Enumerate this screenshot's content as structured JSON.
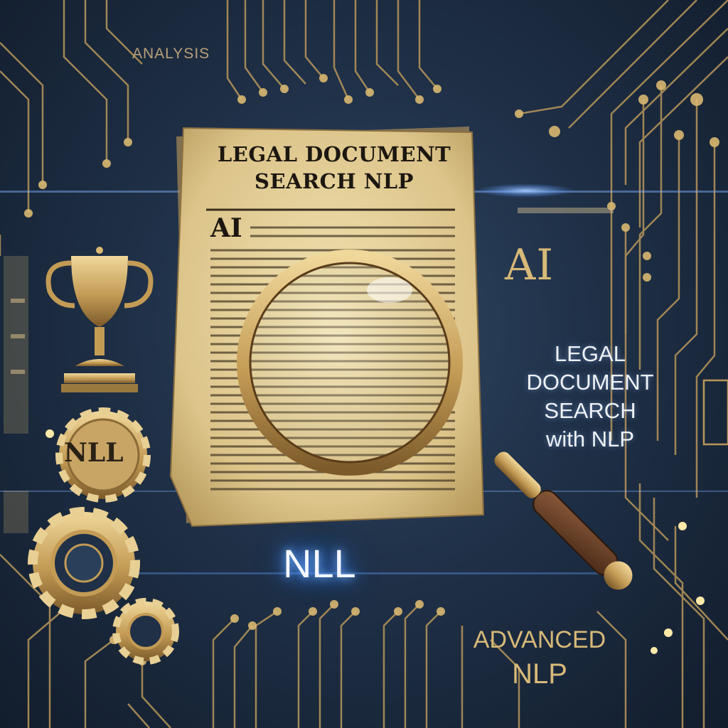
{
  "labels": {
    "top_left": "ANALYSIS",
    "document_title": "LEGAL DOCUMENT SEARCH NLP",
    "document_tag": "AI",
    "side_tag": "AI",
    "side_title_lines": [
      "LEGAL",
      "DOCUMENT",
      "SEARCH",
      "with NLP"
    ],
    "glow_text": "NLL",
    "gear_text": "NLL",
    "bottom_lines": [
      "ADVANCED",
      "NLP"
    ]
  },
  "colors": {
    "background": "#1f3047",
    "gold": "#d7b978",
    "paper": "#e6d29a",
    "glow": "#4d96ff"
  },
  "icons": [
    "trophy-icon",
    "gear-icon",
    "magnifying-glass-icon",
    "circuit-lines"
  ]
}
